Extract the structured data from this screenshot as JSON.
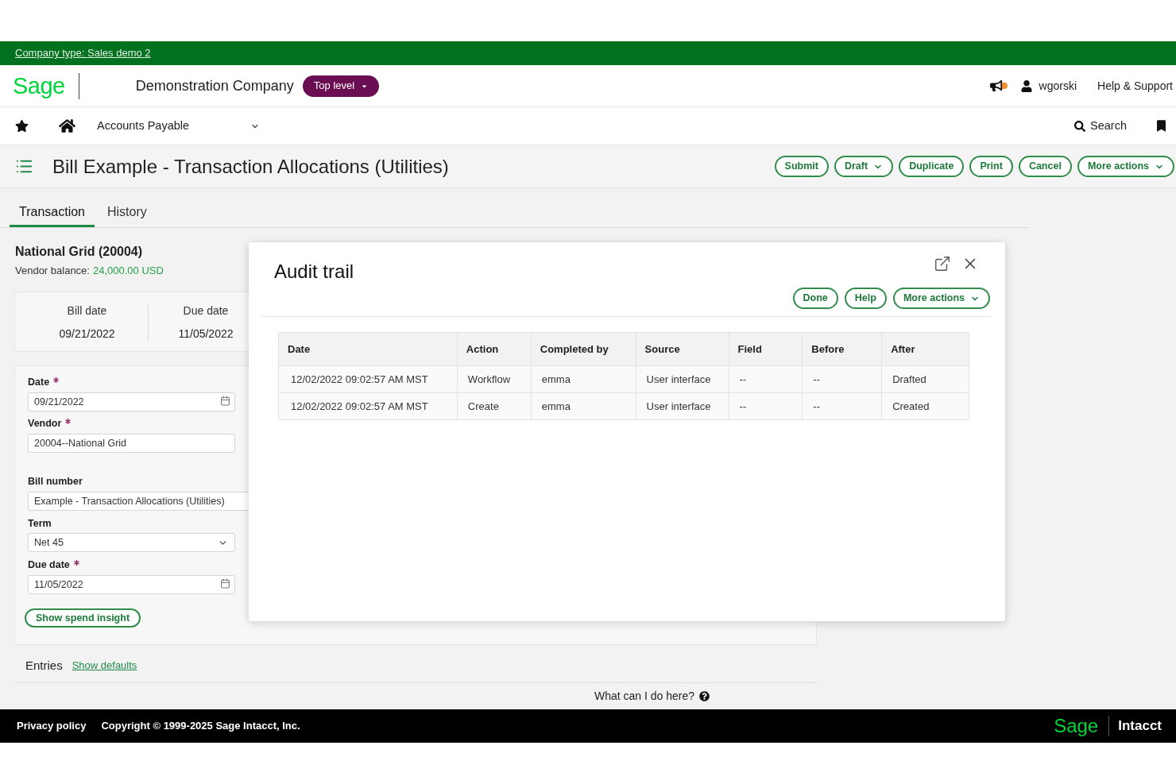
{
  "company_bar": {
    "text": "Company type: Sales demo 2"
  },
  "header": {
    "logo": "Sage",
    "company": "Demonstration Company",
    "level_menu": "Top level",
    "user": "wgorski",
    "help": "Help & Support"
  },
  "nav": {
    "module": "Accounts Payable",
    "search": "Search"
  },
  "page": {
    "title": "Bill Example - Transaction Allocations (Utilities)",
    "actions": [
      {
        "label": "Submit",
        "menu": false
      },
      {
        "label": "Draft",
        "menu": true
      },
      {
        "label": "Duplicate",
        "menu": false
      },
      {
        "label": "Print",
        "menu": false
      },
      {
        "label": "Cancel",
        "menu": false
      },
      {
        "label": "More actions",
        "menu": true
      }
    ]
  },
  "tabs": [
    {
      "label": "Transaction",
      "selected": true
    },
    {
      "label": "History",
      "selected": false
    }
  ],
  "vendor": {
    "name": "National Grid (20004)",
    "balance_label": "Vendor balance:",
    "balance": "24,000.00 USD"
  },
  "summary": [
    {
      "label": "Bill date",
      "value": "09/21/2022"
    },
    {
      "label": "Due date",
      "value": "11/05/2022"
    }
  ],
  "form": {
    "fields": [
      {
        "label": "Date",
        "required": true,
        "kind": "date",
        "value": "09/21/2022"
      },
      {
        "label": "Vendor",
        "required": true,
        "kind": "text",
        "value": "20004--National Grid"
      },
      {
        "label": "Bill number",
        "required": false,
        "kind": "text",
        "value": "Example - Transaction Allocations (Utilities)"
      },
      {
        "label": "Term",
        "required": false,
        "kind": "select",
        "value": "Net 45"
      },
      {
        "label": "Due date",
        "required": true,
        "kind": "date",
        "value": "11/05/2022"
      }
    ],
    "button": "Show spend insight"
  },
  "entries": {
    "label": "Entries",
    "link": "Show defaults"
  },
  "help_link": "What can I do here?",
  "footer": {
    "privacy": "Privacy policy",
    "copyright": "Copyright © 1999-2025 Sage Intacct, Inc.",
    "logo": "Sage",
    "product": "Intacct"
  },
  "dialog": {
    "title": "Audit trail",
    "actions": [
      {
        "label": "Done",
        "menu": false
      },
      {
        "label": "Help",
        "menu": false
      },
      {
        "label": "More actions",
        "menu": true
      }
    ],
    "table": {
      "columns": [
        "Date",
        "Action",
        "Completed by",
        "Source",
        "Field",
        "Before",
        "After"
      ],
      "rows": [
        [
          "12/02/2022 09:02:57 AM MST",
          "Workflow",
          "emma",
          "User interface",
          "--",
          "--",
          "Drafted"
        ],
        [
          "12/02/2022 09:02:57 AM MST",
          "Create",
          "emma",
          "User interface",
          "--",
          "--",
          "Created"
        ]
      ]
    }
  }
}
